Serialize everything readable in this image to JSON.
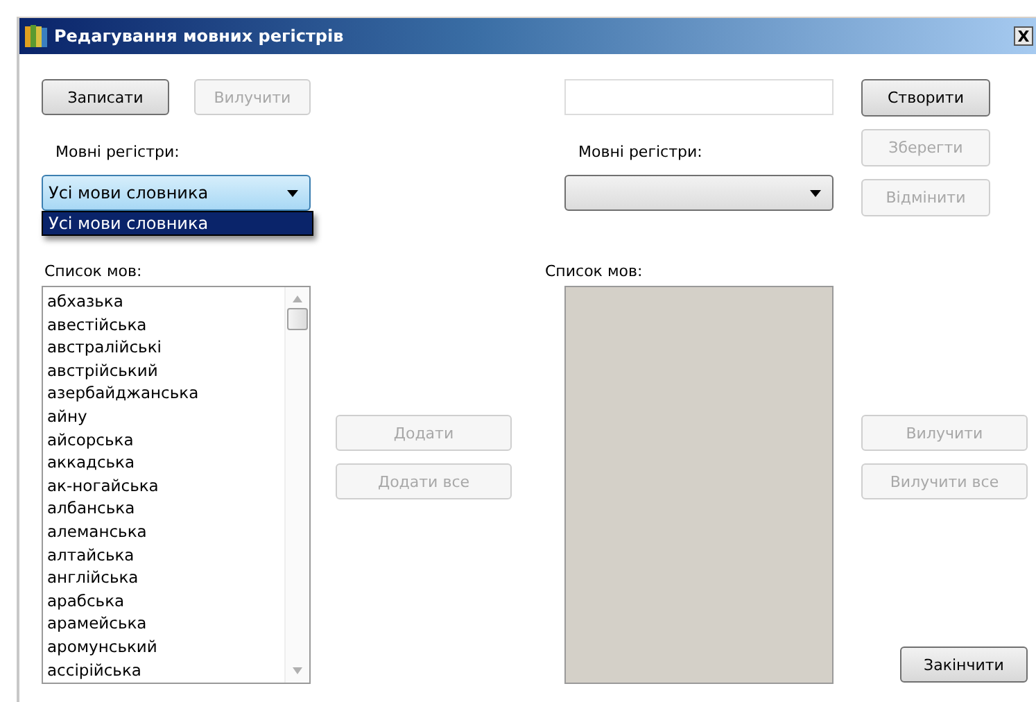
{
  "window": {
    "title": "Редагування мовних регістрів",
    "close": "X"
  },
  "left": {
    "buttons": [
      {
        "label": "Записати",
        "disabled": false
      },
      {
        "label": "Вилучити",
        "disabled": true
      }
    ],
    "registers_label": "Мовні регістри:",
    "registers_combo": {
      "value": "Усі мови словника",
      "focused": true,
      "expanded": true,
      "options": [
        {
          "label": "Усі мови словника",
          "selected": true
        }
      ]
    },
    "list_label": "Список мов:",
    "languages_list": {
      "disabled": false,
      "items": [
        "абхазька",
        "авестійська",
        "австралійські",
        "австрійський",
        "азербайджанська",
        "айну",
        "айсорська",
        "аккадська",
        "ак-ногайська",
        "албанська",
        "алеманська",
        "алтайська",
        "англійська",
        "арабська",
        "арамейська",
        "аромунський",
        "ассірійська"
      ]
    }
  },
  "middle": {
    "buttons": [
      {
        "label": "Додати",
        "disabled": true
      },
      {
        "label": "Додати все",
        "disabled": true
      }
    ]
  },
  "right": {
    "registers_label": "Мовні регістри:",
    "registers_combo": {
      "focused": false,
      "expanded": false
    },
    "list_label": "Список мов:",
    "languages_list": {
      "disabled": true
    },
    "side_buttons": [
      {
        "label": "Створити",
        "disabled": false
      },
      {
        "label": "Зберегти",
        "disabled": true
      },
      {
        "label": "Відмінити",
        "disabled": true
      }
    ],
    "remove_buttons": [
      {
        "label": "Вилучити",
        "disabled": true
      },
      {
        "label": "Вилучити все",
        "disabled": true
      }
    ],
    "finish_button": {
      "label": "Закінчити",
      "disabled": false
    }
  }
}
